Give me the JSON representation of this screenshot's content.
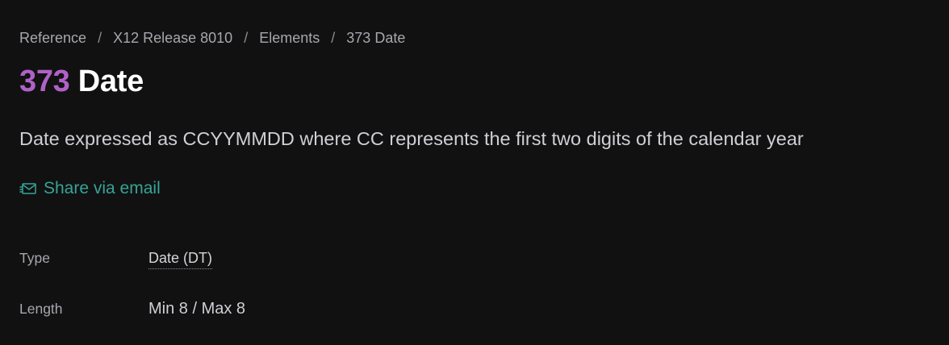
{
  "breadcrumb": {
    "items": [
      {
        "label": "Reference"
      },
      {
        "label": "X12 Release 8010"
      },
      {
        "label": "Elements"
      }
    ],
    "current": "373 Date",
    "separator": "/"
  },
  "title": {
    "code": "373",
    "name": "Date"
  },
  "description": "Date expressed as CCYYMMDD where CC represents the first two digits of the calendar year",
  "share": {
    "label": "Share via email",
    "icon": "email-icon"
  },
  "meta": {
    "type": {
      "label": "Type",
      "value": "Date (DT)"
    },
    "length": {
      "label": "Length",
      "value": "Min 8 / Max 8"
    }
  },
  "colors": {
    "background": "#111112",
    "code_accent": "#b061c7",
    "link_accent": "#36a496",
    "muted_text": "#a7a7ad"
  }
}
